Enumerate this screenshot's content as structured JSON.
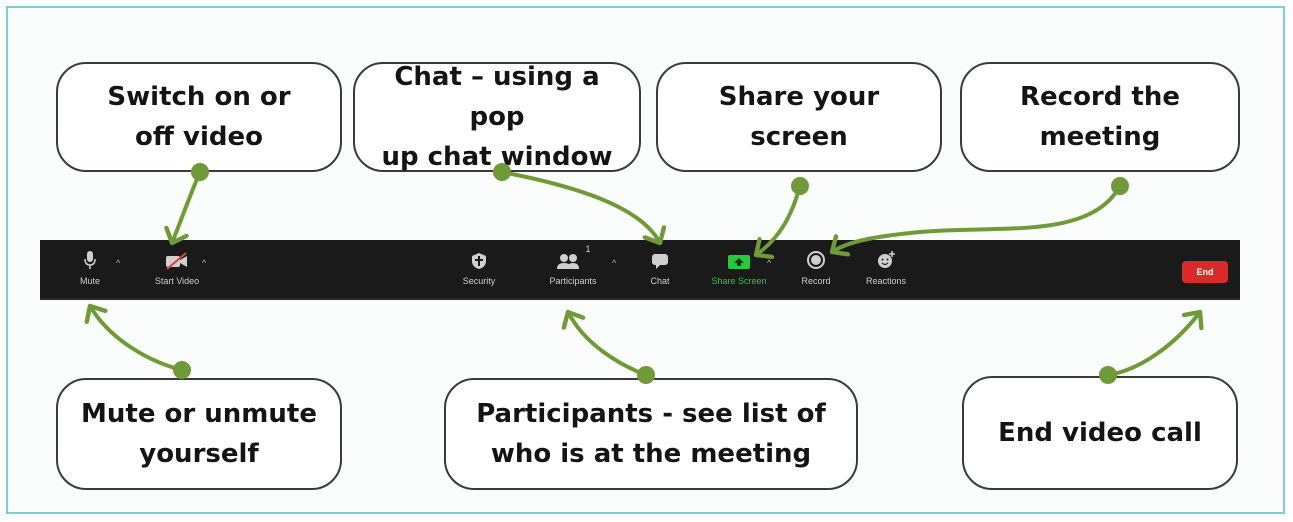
{
  "callouts": {
    "video": [
      "Switch on or",
      "off video"
    ],
    "chat": [
      "Chat – using a pop",
      "up chat window"
    ],
    "share": [
      "Share your",
      "screen"
    ],
    "record": [
      "Record the",
      "meeting"
    ],
    "mute": [
      "Mute or unmute",
      "yourself"
    ],
    "participants": [
      "Participants - see list of",
      "who is at the meeting"
    ],
    "end": [
      "End video call"
    ]
  },
  "toolbar": {
    "mute_label": "Mute",
    "start_video_label": "Start Video",
    "security_label": "Security",
    "participants_label": "Participants",
    "participants_count": "1",
    "chat_label": "Chat",
    "share_label": "Share Screen",
    "record_label": "Record",
    "reactions_label": "Reactions",
    "end_label": "End"
  },
  "colors": {
    "arrow": "#6f9a38",
    "share_green": "#28c840",
    "end_red": "#d92b2b",
    "frame": "#7ecfcf",
    "toolbar_bg": "#1a1a1a"
  }
}
